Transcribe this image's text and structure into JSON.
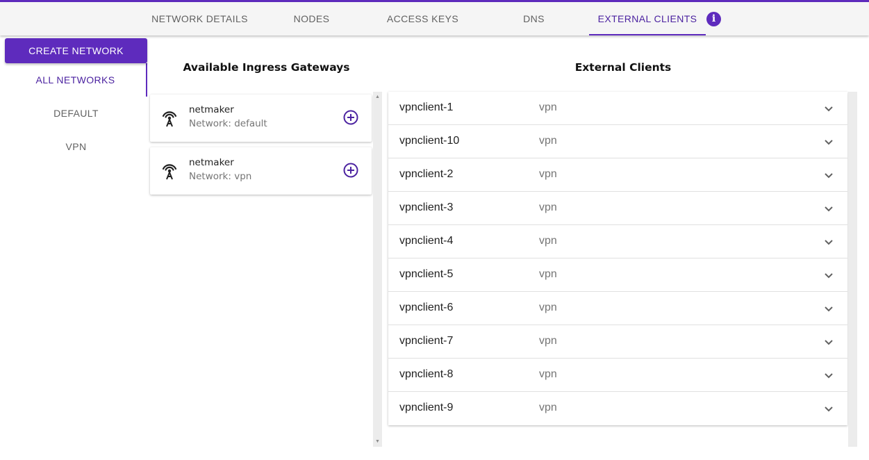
{
  "tabs": [
    {
      "label": "NETWORK DETAILS"
    },
    {
      "label": "NODES"
    },
    {
      "label": "ACCESS KEYS"
    },
    {
      "label": "DNS"
    },
    {
      "label": "EXTERNAL CLIENTS"
    }
  ],
  "info_icon": {
    "glyph": "i",
    "icon": "info-icon"
  },
  "sidebar": {
    "create_label": "CREATE NETWORK",
    "items": [
      {
        "label": "ALL NETWORKS"
      },
      {
        "label": "DEFAULT"
      },
      {
        "label": "VPN"
      }
    ]
  },
  "gateways": {
    "title": "Available Ingress Gateways",
    "items": [
      {
        "name": "netmaker",
        "network": "Network: default",
        "icon": "antenna-icon",
        "action_icon": "add-circle-icon"
      },
      {
        "name": "netmaker",
        "network": "Network: vpn",
        "icon": "antenna-icon",
        "action_icon": "add-circle-icon"
      }
    ]
  },
  "clients": {
    "title": "External Clients",
    "items": [
      {
        "name": "vpnclient-1",
        "network": "vpn"
      },
      {
        "name": "vpnclient-10",
        "network": "vpn"
      },
      {
        "name": "vpnclient-2",
        "network": "vpn"
      },
      {
        "name": "vpnclient-3",
        "network": "vpn"
      },
      {
        "name": "vpnclient-4",
        "network": "vpn"
      },
      {
        "name": "vpnclient-5",
        "network": "vpn"
      },
      {
        "name": "vpnclient-6",
        "network": "vpn"
      },
      {
        "name": "vpnclient-7",
        "network": "vpn"
      },
      {
        "name": "vpnclient-8",
        "network": "vpn"
      },
      {
        "name": "vpnclient-9",
        "network": "vpn"
      }
    ]
  },
  "colors": {
    "accent": "#5e2bbd",
    "accent_text": "#4b22a0",
    "muted": "#757575"
  }
}
